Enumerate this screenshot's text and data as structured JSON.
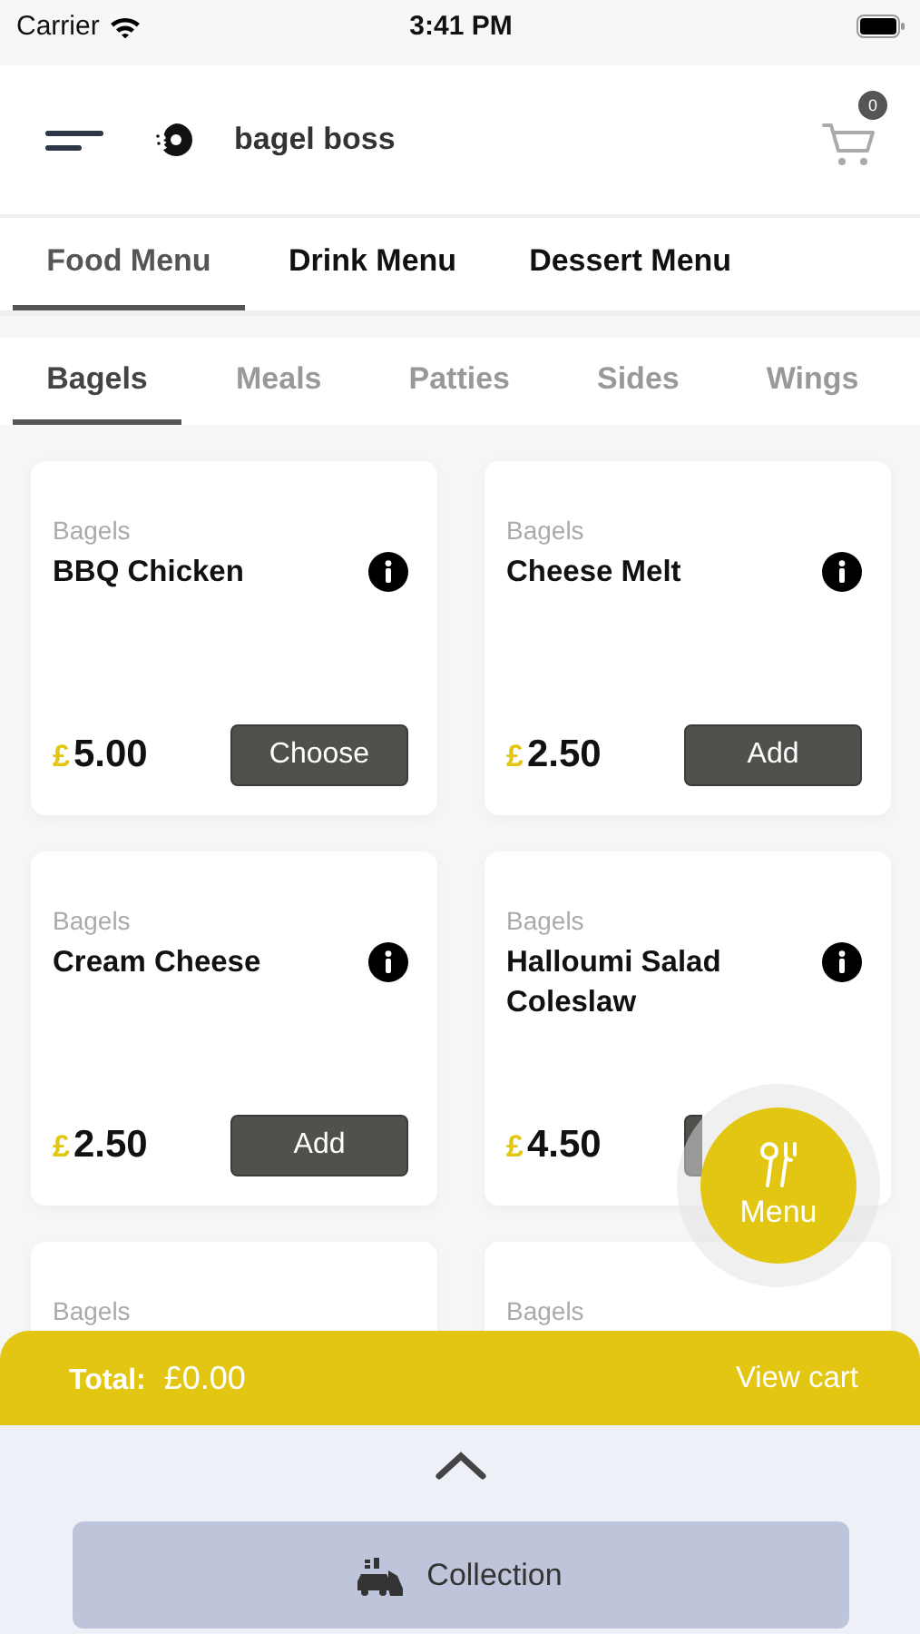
{
  "status_bar": {
    "carrier": "Carrier",
    "time": "3:41 PM"
  },
  "header": {
    "title": "bagel boss",
    "cart_count": "0"
  },
  "menu_tabs": [
    {
      "label": "Food Menu",
      "selected": true
    },
    {
      "label": "Drink Menu",
      "selected": false
    },
    {
      "label": "Dessert Menu",
      "selected": false
    }
  ],
  "category_tabs": [
    {
      "label": "Bagels",
      "selected": true
    },
    {
      "label": "Meals",
      "selected": false
    },
    {
      "label": "Patties",
      "selected": false
    },
    {
      "label": "Sides",
      "selected": false
    },
    {
      "label": "Wings",
      "selected": false
    }
  ],
  "products": [
    {
      "category": "Bagels",
      "name": "BBQ Chicken",
      "currency": "£",
      "price": "5.00",
      "action": "Choose"
    },
    {
      "category": "Bagels",
      "name": "Cheese Melt",
      "currency": "£",
      "price": "2.50",
      "action": "Add"
    },
    {
      "category": "Bagels",
      "name": "Cream Cheese",
      "currency": "£",
      "price": "2.50",
      "action": "Add"
    },
    {
      "category": "Bagels",
      "name": "Halloumi Salad Coleslaw",
      "currency": "£",
      "price": "4.50"
    },
    {
      "category": "Bagels"
    },
    {
      "category": "Bagels"
    }
  ],
  "menu_button": {
    "label": "Menu"
  },
  "cart_bar": {
    "total_label": "Total:",
    "total": "£0.00",
    "view_cart": "View cart"
  },
  "bottom_panel": {
    "collection_button": "Collection"
  }
}
